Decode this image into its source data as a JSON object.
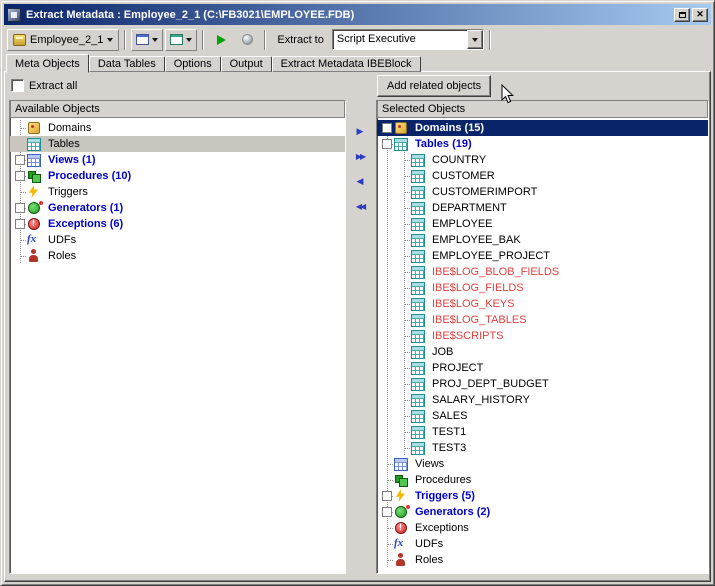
{
  "window": {
    "title": "Extract Metadata : Employee_2_1 (C:\\FB3021\\EMPLOYEE.FDB)",
    "controls": {
      "close_glyph": "✕"
    }
  },
  "toolbar": {
    "database_selector": "Employee_2_1",
    "extract_to_label": "Extract to",
    "extract_to_value": "Script Executive"
  },
  "tabs": {
    "active_index": 0,
    "items": [
      "Meta Objects",
      "Data Tables",
      "Options",
      "Output",
      "Extract Metadata IBEBlock"
    ]
  },
  "left_panel": {
    "extract_all_label": "Extract all",
    "header": "Available Objects",
    "tree": [
      {
        "label": "Domains",
        "icon": "domain",
        "level": 0,
        "expand": null,
        "style": "normal"
      },
      {
        "label": "Tables",
        "icon": "table",
        "level": 0,
        "expand": null,
        "style": "normal",
        "selected": "inactive"
      },
      {
        "label": "Views (1)",
        "icon": "view",
        "level": 0,
        "expand": "plus",
        "style": "bold-blue"
      },
      {
        "label": "Procedures (10)",
        "icon": "procedure",
        "level": 0,
        "expand": "plus",
        "style": "bold-blue"
      },
      {
        "label": "Triggers",
        "icon": "trigger",
        "level": 0,
        "expand": null,
        "style": "normal"
      },
      {
        "label": "Generators (1)",
        "icon": "generator",
        "level": 0,
        "expand": "plus",
        "style": "bold-blue"
      },
      {
        "label": "Exceptions (6)",
        "icon": "exception",
        "level": 0,
        "expand": "plus",
        "style": "bold-blue"
      },
      {
        "label": "UDFs",
        "icon": "udf",
        "level": 0,
        "expand": null,
        "style": "normal"
      },
      {
        "label": "Roles",
        "icon": "role",
        "level": 0,
        "expand": null,
        "style": "normal"
      }
    ]
  },
  "transfer_buttons": [
    {
      "name": "move-selected-right",
      "glyph": "▶"
    },
    {
      "name": "move-all-right",
      "glyph": "▶▶"
    },
    {
      "name": "move-selected-left",
      "glyph": "◀"
    },
    {
      "name": "move-all-left",
      "glyph": "◀◀"
    }
  ],
  "right_panel": {
    "add_related_button": "Add related objects",
    "header": "Selected Objects",
    "tree": [
      {
        "label": "Domains (15)",
        "icon": "domain",
        "level": 0,
        "expand": "plus",
        "style": "bold-blue",
        "selected": "focus"
      },
      {
        "label": "Tables (19)",
        "icon": "table",
        "level": 0,
        "expand": "minus",
        "style": "bold-blue"
      },
      {
        "label": "COUNTRY",
        "icon": "table",
        "level": 1,
        "style": "normal"
      },
      {
        "label": "CUSTOMER",
        "icon": "table",
        "level": 1,
        "style": "normal"
      },
      {
        "label": "CUSTOMERIMPORT",
        "icon": "table",
        "level": 1,
        "style": "normal"
      },
      {
        "label": "DEPARTMENT",
        "icon": "table",
        "level": 1,
        "style": "normal"
      },
      {
        "label": "EMPLOYEE",
        "icon": "table",
        "level": 1,
        "style": "normal"
      },
      {
        "label": "EMPLOYEE_BAK",
        "icon": "table",
        "level": 1,
        "style": "normal"
      },
      {
        "label": "EMPLOYEE_PROJECT",
        "icon": "table",
        "level": 1,
        "style": "normal"
      },
      {
        "label": "IBE$LOG_BLOB_FIELDS",
        "icon": "table",
        "level": 1,
        "style": "red"
      },
      {
        "label": "IBE$LOG_FIELDS",
        "icon": "table",
        "level": 1,
        "style": "red"
      },
      {
        "label": "IBE$LOG_KEYS",
        "icon": "table",
        "level": 1,
        "style": "red"
      },
      {
        "label": "IBE$LOG_TABLES",
        "icon": "table",
        "level": 1,
        "style": "red"
      },
      {
        "label": "IBE$SCRIPTS",
        "icon": "table",
        "level": 1,
        "style": "red"
      },
      {
        "label": "JOB",
        "icon": "table",
        "level": 1,
        "style": "normal"
      },
      {
        "label": "PROJECT",
        "icon": "table",
        "level": 1,
        "style": "normal"
      },
      {
        "label": "PROJ_DEPT_BUDGET",
        "icon": "table",
        "level": 1,
        "style": "normal"
      },
      {
        "label": "SALARY_HISTORY",
        "icon": "table",
        "level": 1,
        "style": "normal"
      },
      {
        "label": "SALES",
        "icon": "table",
        "level": 1,
        "style": "normal"
      },
      {
        "label": "TEST1",
        "icon": "table",
        "level": 1,
        "style": "normal"
      },
      {
        "label": "TEST3",
        "icon": "table",
        "level": 1,
        "style": "normal"
      },
      {
        "label": "Views",
        "icon": "view",
        "level": 0,
        "expand": null,
        "style": "normal"
      },
      {
        "label": "Procedures",
        "icon": "procedure",
        "level": 0,
        "expand": null,
        "style": "normal"
      },
      {
        "label": "Triggers (5)",
        "icon": "trigger",
        "level": 0,
        "expand": "plus",
        "style": "bold-blue"
      },
      {
        "label": "Generators (2)",
        "icon": "generator",
        "level": 0,
        "expand": "plus",
        "style": "bold-blue"
      },
      {
        "label": "Exceptions",
        "icon": "exception",
        "level": 0,
        "expand": null,
        "style": "normal"
      },
      {
        "label": "UDFs",
        "icon": "udf",
        "level": 0,
        "expand": null,
        "style": "normal"
      },
      {
        "label": "Roles",
        "icon": "role",
        "level": 0,
        "expand": null,
        "style": "normal"
      }
    ]
  },
  "colors": {
    "titlebar_gradient_start": "#0A246A",
    "titlebar_gradient_end": "#A6CAF0",
    "bold_item_blue": "#0000CC",
    "system_table_red": "#E04040",
    "selection_navy": "#0A246A"
  }
}
